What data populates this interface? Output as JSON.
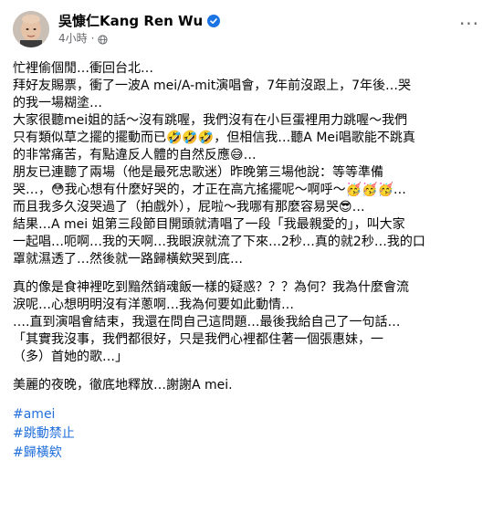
{
  "post": {
    "author": "吳慷仁Kang Ren Wu",
    "time": "4小時",
    "dot": "·",
    "more": "···"
  },
  "paragraphs": [
    [
      "忙裡偷個閒…衝回台北…",
      "拜好友賜票，衝了一波A mei/A-mit演唱會，7年前沒跟上，7年後…哭",
      "的我一場糊塗…",
      "大家很聽mei姐的話～沒有跳喔，我們沒有在小巨蛋裡用力跳喔～我們",
      "只有類似草之擺的擺動而已🤣🤣🤣，但相信我…聽A Mei唱歌能不跳真",
      "的非常痛苦，有點違反人體的自然反應😅…",
      "朋友已連聽了兩場（他是最死忠歌迷）昨晚第三場他說：等等準備",
      "哭…，😳我心想有什麼好哭的，才正在高亢搖擺呢～啊呼～🥳🥳🥳…",
      "而且我多久沒哭過了（拍戲外），屁啦～我哪有那麼容易哭😎…",
      "結果…A mei 姐第三段節目開頭就清唱了一段「我最親愛的」，叫大家",
      "一起唱…呃啊…我的天啊…我眼淚就流了下來…2秒…真的就2秒…我的口",
      "罩就濕透了…然後就一路歸橫欸哭到底…"
    ],
    [
      "真的像是食神裡吃到黯然銷魂飯一樣的疑惑？？？為何？我為什麼會流",
      "淚呢…心想明明沒有洋蔥啊…我為何要如此動情…",
      "….直到演唱會結束，我還在問自己這問題…最後我給自己了一句話…",
      "「其實我沒事，我們都很好，只是我們心裡都住著一個張惠妹，一",
      "（多）首她的歌…」"
    ],
    [
      "美麗的夜晚，徹底地釋放…謝謝A mei."
    ]
  ],
  "hashtags": [
    "#amei",
    "#跳動禁止",
    "#歸橫欸"
  ],
  "colors": {
    "text": "#050505",
    "secondary": "#65676b",
    "link": "#216fdb",
    "verified": "#1b74e4"
  },
  "icons": {
    "verified": "verified-badge-icon",
    "privacy": "globe-icon",
    "more": "more-options-icon"
  }
}
